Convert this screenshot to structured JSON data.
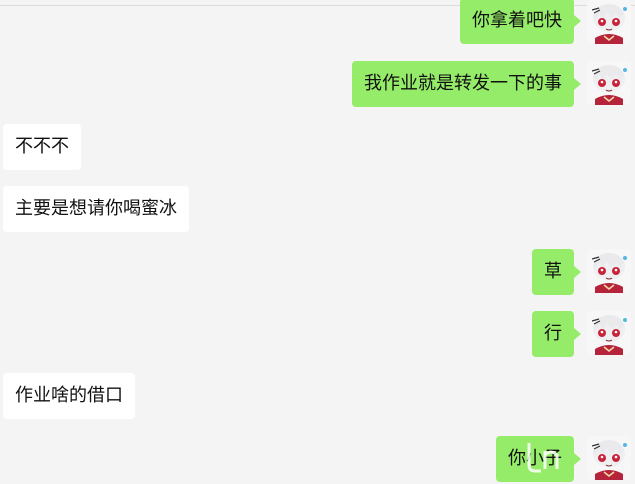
{
  "chat": {
    "messages": [
      {
        "side": "out",
        "text": "你拿着吧快"
      },
      {
        "side": "out",
        "text": "我作业就是转发一下的事"
      },
      {
        "side": "in",
        "text": "不不不"
      },
      {
        "side": "in",
        "text": "主要是想请你喝蜜冰"
      },
      {
        "side": "out",
        "text": "草"
      },
      {
        "side": "out",
        "text": "行"
      },
      {
        "side": "in",
        "text": "作业啥的借口"
      },
      {
        "side": "out",
        "text": "你小子"
      }
    ]
  },
  "colors": {
    "background": "#f4f4f4",
    "incoming_bubble": "#ffffff",
    "outgoing_bubble": "#95ec69"
  },
  "icons": {
    "avatar": "anime-girl-avatar-icon",
    "watermark": "watermark-logo-icon"
  }
}
